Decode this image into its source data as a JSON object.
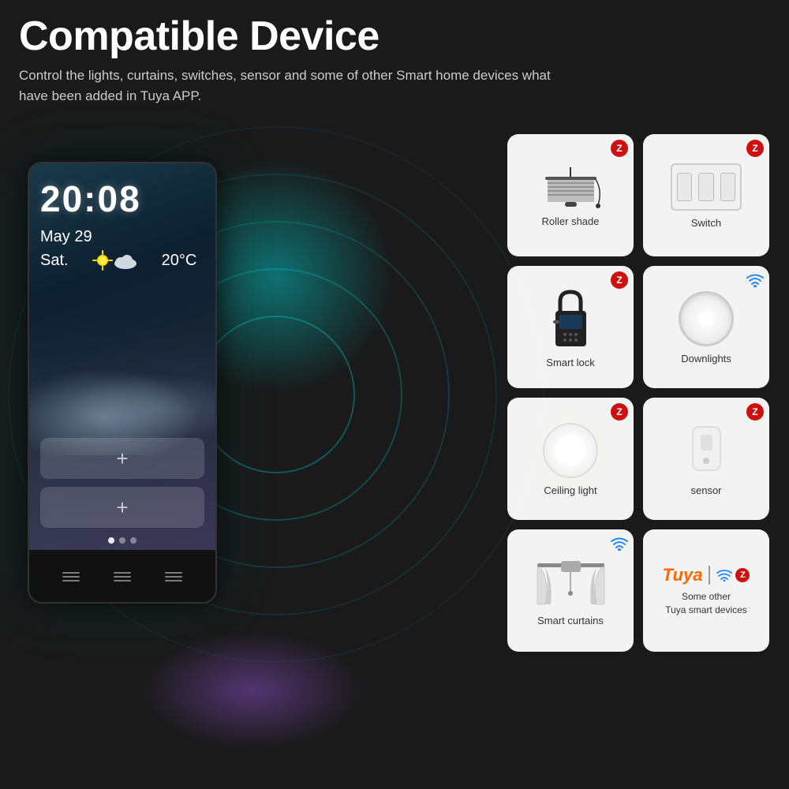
{
  "page": {
    "background_color": "#1a1a1a",
    "title": "Compatible Device",
    "subtitle": "Control the lights, curtains, switches, sensor and some of other Smart home devices what have been added in Tuya APP."
  },
  "panel": {
    "time": "20:08",
    "date_line1": "May 29",
    "date_line2_day": "Sat.",
    "date_line2_temp": "20°C",
    "add_button_label": "+",
    "bottom_buttons": [
      "≡",
      "≡",
      "≡"
    ]
  },
  "devices": [
    {
      "id": "roller-shade",
      "label": "Roller shade",
      "badge_type": "zigbee"
    },
    {
      "id": "switch",
      "label": "Switch",
      "badge_type": "zigbee"
    },
    {
      "id": "smart-lock",
      "label": "Smart lock",
      "badge_type": "zigbee"
    },
    {
      "id": "downlights",
      "label": "Downlights",
      "badge_type": "wifi"
    },
    {
      "id": "ceiling-light",
      "label": "Ceiling light",
      "badge_type": "zigbee"
    },
    {
      "id": "sensor",
      "label": "sensor",
      "badge_type": "zigbee"
    },
    {
      "id": "smart-curtains",
      "label": "Smart curtains",
      "badge_type": "wifi"
    },
    {
      "id": "tuya",
      "label": "Some other\nTuya smart devices",
      "badge_type": "both"
    }
  ],
  "zigbee_badge_letter": "Z",
  "wifi_badge_symbol": "📶"
}
